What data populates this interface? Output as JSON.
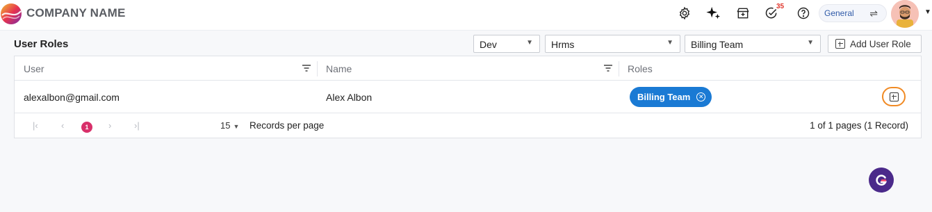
{
  "header": {
    "company_name": "COMPANY NAME",
    "notification_count": "35",
    "workspace_label": "General",
    "icons": [
      "settings-icon",
      "sparkle-icon",
      "store-icon",
      "task-check-icon",
      "help-icon",
      "swap-icon"
    ]
  },
  "toolbar": {
    "title": "User Roles",
    "filters": [
      {
        "name": "environment",
        "value": "Dev"
      },
      {
        "name": "application",
        "value": "Hrms"
      },
      {
        "name": "team",
        "value": "Billing Team"
      }
    ],
    "add_label": "Add User Role"
  },
  "grid": {
    "columns": [
      "User",
      "Name",
      "Roles"
    ],
    "rows": [
      {
        "user": "alexalbon@gmail.com",
        "name": "Alex Albon",
        "roles": [
          "Billing Team"
        ]
      }
    ]
  },
  "pager": {
    "current_page": "1",
    "page_size": "15",
    "page_size_label": "Records per page",
    "summary": "1 of 1 pages (1 Record)"
  },
  "colors": {
    "chip": "#1a7ad4",
    "highlight": "#f08a24",
    "page_badge": "#d8306a",
    "grammarly": "#4b2a8a"
  }
}
